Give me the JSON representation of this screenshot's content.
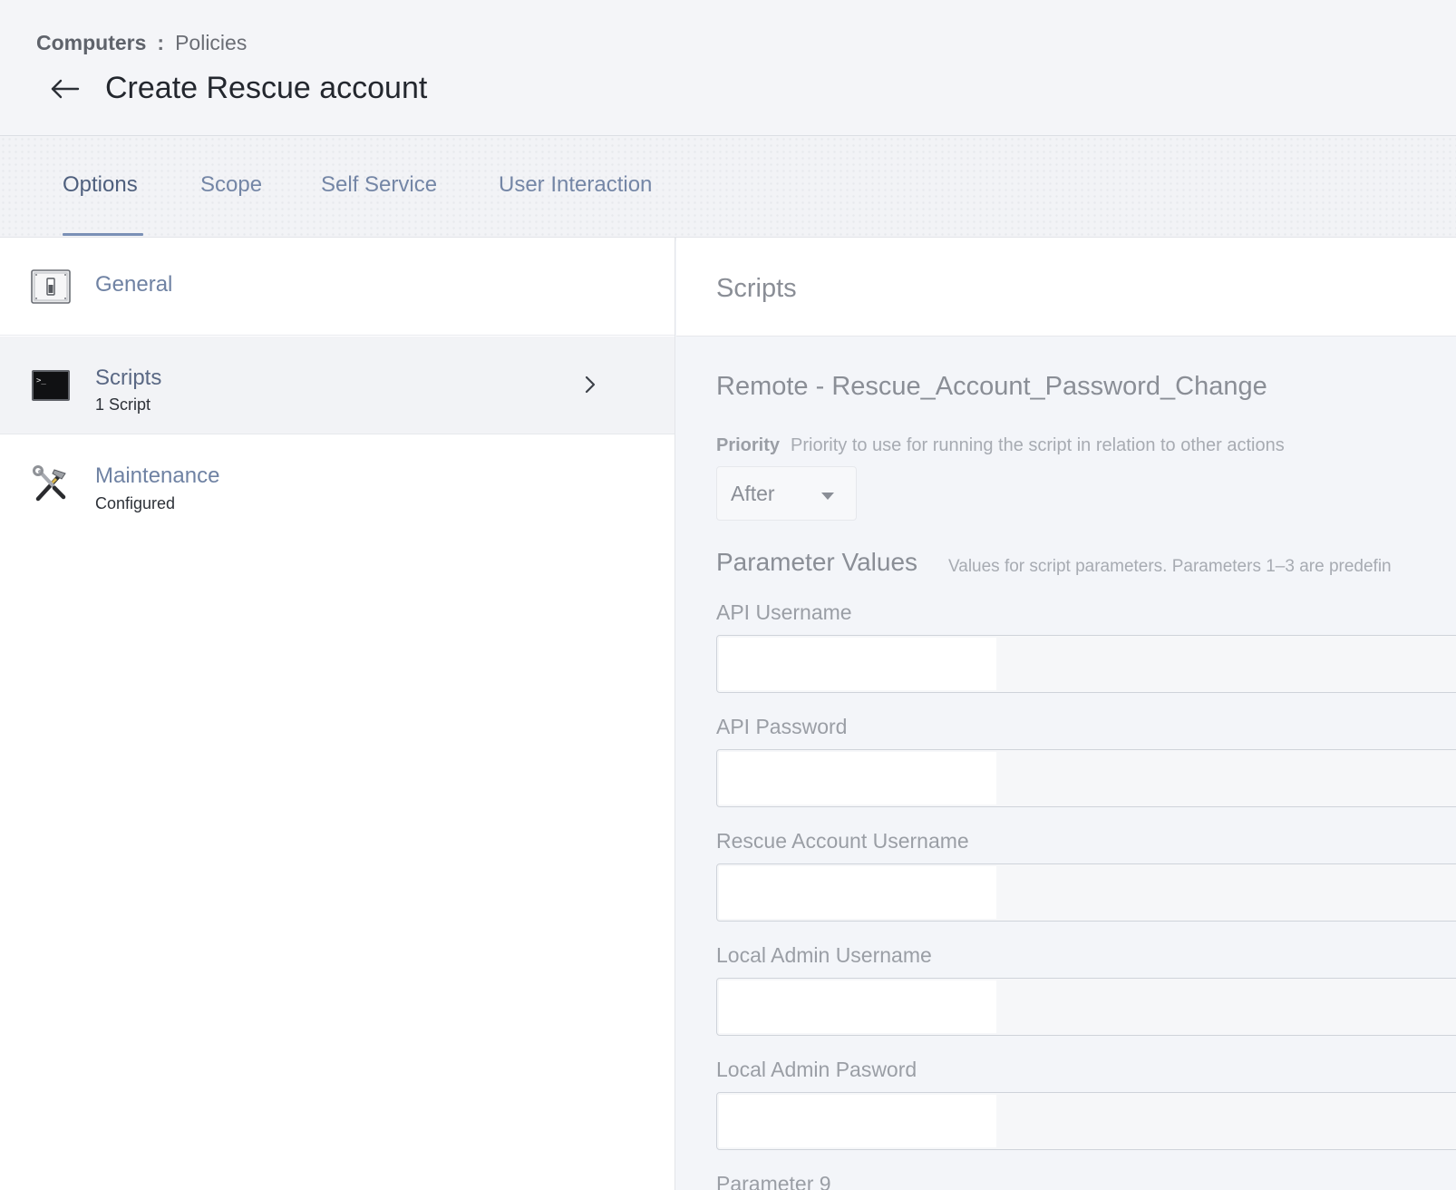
{
  "breadcrumb": {
    "root": "Computers",
    "separator": ":",
    "current": "Policies"
  },
  "page": {
    "title": "Create Rescue account",
    "back_icon": "back-arrow-icon"
  },
  "tabs": [
    {
      "label": "Options",
      "active": true
    },
    {
      "label": "Scope",
      "active": false
    },
    {
      "label": "Self Service",
      "active": false
    },
    {
      "label": "User Interaction",
      "active": false
    }
  ],
  "sidebar": {
    "items": [
      {
        "label": "General",
        "sublabel": "",
        "icon": "switch-icon",
        "selected": false
      },
      {
        "label": "Scripts",
        "sublabel": "1 Script",
        "icon": "terminal-icon",
        "selected": true
      },
      {
        "label": "Maintenance",
        "sublabel": "Configured",
        "icon": "hammer-wrench-icon",
        "selected": false
      }
    ]
  },
  "panel": {
    "title": "Scripts",
    "script_name": "Remote - Rescue_Account_Password_Change",
    "priority": {
      "label": "Priority",
      "help": "Priority to use for running the script in relation to other actions",
      "value": "After"
    },
    "parameters": {
      "heading": "Parameter Values",
      "help": "Values for script parameters. Parameters 1–3 are predefin",
      "fields": [
        {
          "label": "API Username",
          "value": ""
        },
        {
          "label": "API Password",
          "value": ""
        },
        {
          "label": "Rescue Account Username",
          "value": ""
        },
        {
          "label": "Local Admin Username",
          "value": ""
        },
        {
          "label": "Local Admin Pasword",
          "value": ""
        }
      ],
      "next_label": "Parameter 9"
    }
  },
  "colors": {
    "accent": "#7a90b6",
    "tab_text": "#7486a6",
    "title_text": "#23272e"
  }
}
